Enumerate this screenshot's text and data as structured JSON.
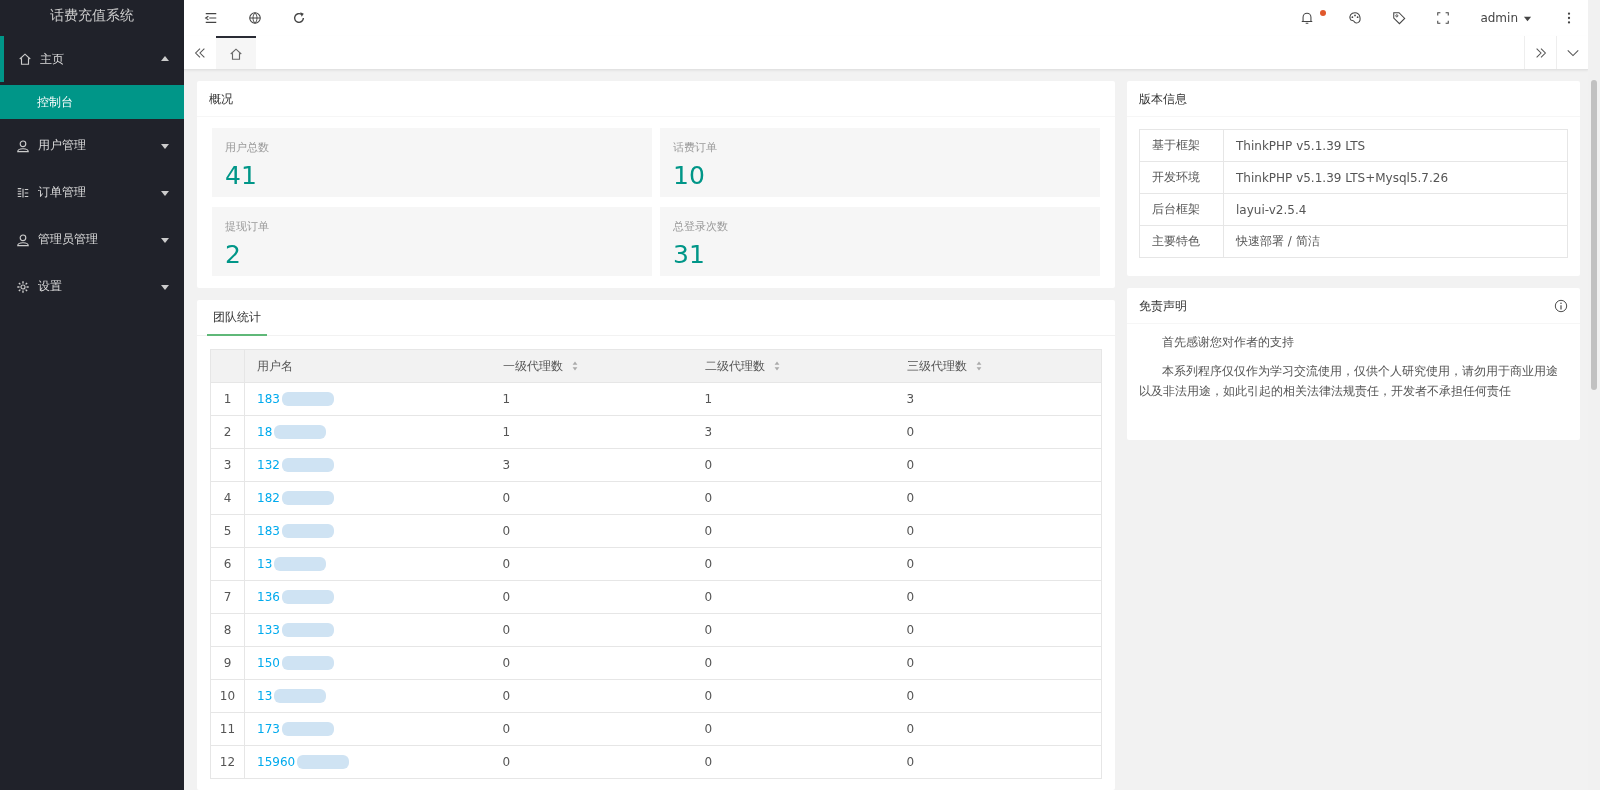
{
  "sidebar": {
    "title": "话费充值系统",
    "items": [
      {
        "kind": "home",
        "label": "主页",
        "expanded": true,
        "children": [
          {
            "label": "控制台",
            "selected": true
          }
        ]
      },
      {
        "kind": "user",
        "label": "用户管理",
        "expanded": false
      },
      {
        "kind": "list",
        "label": "订单管理",
        "expanded": false
      },
      {
        "kind": "user",
        "label": "管理员管理",
        "expanded": false
      },
      {
        "kind": "gear",
        "label": "设置",
        "expanded": false
      }
    ]
  },
  "topbar": {
    "user": "admin",
    "notification": true
  },
  "tabs": [
    {
      "kind": "home",
      "selected": true
    }
  ],
  "overview": {
    "title": "概况",
    "stats": [
      {
        "label": "用户总数",
        "value": "41"
      },
      {
        "label": "话费订单",
        "value": "10"
      },
      {
        "label": "提现订单",
        "value": "2"
      },
      {
        "label": "总登录次数",
        "value": "31"
      }
    ]
  },
  "team": {
    "tab": "团队统计",
    "columns": [
      {
        "label": "用户名",
        "sortable": false
      },
      {
        "label": "一级代理数",
        "sortable": true
      },
      {
        "label": "二级代理数",
        "sortable": true
      },
      {
        "label": "三级代理数",
        "sortable": true
      }
    ],
    "rows": [
      {
        "index": "1",
        "user": "183",
        "c1": "1",
        "c2": "1",
        "c3": "3"
      },
      {
        "index": "2",
        "user": "18",
        "c1": "1",
        "c2": "3",
        "c3": "0"
      },
      {
        "index": "3",
        "user": "132",
        "c1": "3",
        "c2": "0",
        "c3": "0"
      },
      {
        "index": "4",
        "user": "182",
        "c1": "0",
        "c2": "0",
        "c3": "0"
      },
      {
        "index": "5",
        "user": "183",
        "c1": "0",
        "c2": "0",
        "c3": "0"
      },
      {
        "index": "6",
        "user": "13",
        "c1": "0",
        "c2": "0",
        "c3": "0"
      },
      {
        "index": "7",
        "user": "136",
        "c1": "0",
        "c2": "0",
        "c3": "0"
      },
      {
        "index": "8",
        "user": "133",
        "c1": "0",
        "c2": "0",
        "c3": "0"
      },
      {
        "index": "9",
        "user": "150",
        "c1": "0",
        "c2": "0",
        "c3": "0"
      },
      {
        "index": "10",
        "user": "13",
        "c1": "0",
        "c2": "0",
        "c3": "0"
      },
      {
        "index": "11",
        "user": "173",
        "c1": "0",
        "c2": "0",
        "c3": "0"
      },
      {
        "index": "12",
        "user": "15960",
        "c1": "0",
        "c2": "0",
        "c3": "0"
      }
    ]
  },
  "version": {
    "title": "版本信息",
    "rows": [
      {
        "key": "基于框架",
        "value": "ThinkPHP v5.1.39 LTS"
      },
      {
        "key": "开发环境",
        "value": "ThinkPHP v5.1.39 LTS+Mysql5.7.26"
      },
      {
        "key": "后台框架",
        "value": "layui-v2.5.4"
      },
      {
        "key": "主要特色",
        "value": "快速部署 / 简洁"
      }
    ]
  },
  "disclaimer": {
    "title": "免责声明",
    "paragraphs": [
      "首先感谢您对作者的支持",
      "本系列程序仅仅作为学习交流使用，仅供个人研究使用，请勿用于商业用途以及非法用途，如此引起的相关法律法规责任，开发者不承担任何责任"
    ]
  }
}
